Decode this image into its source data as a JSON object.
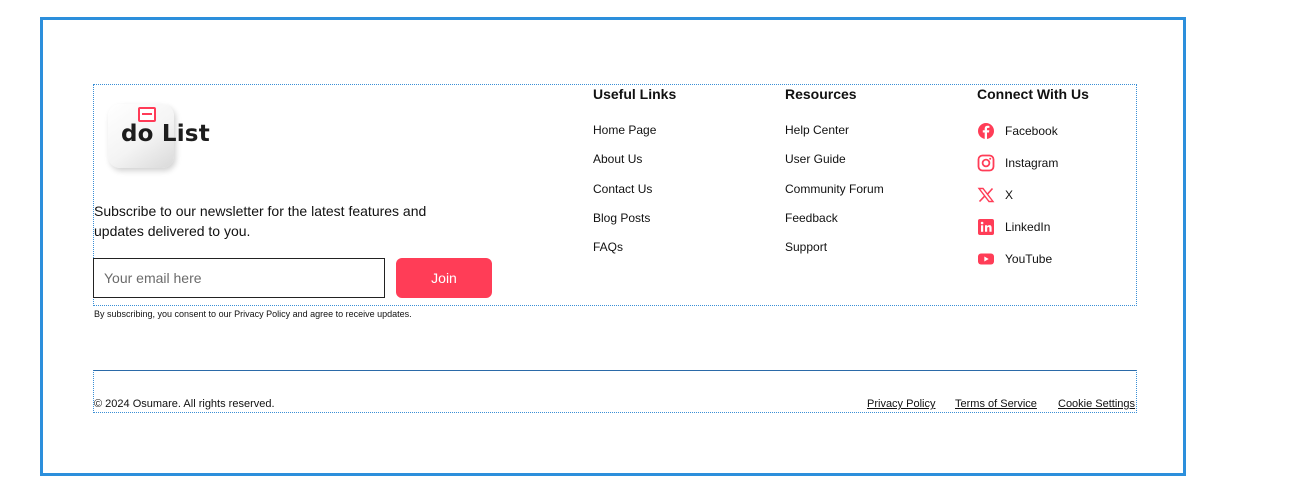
{
  "brand": {
    "logo_text": "do List"
  },
  "newsletter": {
    "description": "Subscribe to our newsletter for the latest features and updates delivered to you.",
    "email_placeholder": "Your email here",
    "join_label": "Join",
    "consent": "By subscribing, you consent to our Privacy Policy and agree to receive updates.",
    "accent_color": "#ff3d57"
  },
  "useful_links": {
    "heading": "Useful Links",
    "items": [
      "Home Page",
      "About Us",
      "Contact Us",
      "Blog Posts",
      "FAQs"
    ]
  },
  "resources": {
    "heading": "Resources",
    "items": [
      "Help Center",
      "User Guide",
      "Community Forum",
      "Feedback",
      "Support"
    ]
  },
  "connect": {
    "heading": "Connect With Us",
    "items": [
      {
        "label": "Facebook",
        "icon": "facebook-icon"
      },
      {
        "label": "Instagram",
        "icon": "instagram-icon"
      },
      {
        "label": "X",
        "icon": "x-icon"
      },
      {
        "label": "LinkedIn",
        "icon": "linkedin-icon"
      },
      {
        "label": "YouTube",
        "icon": "youtube-icon"
      }
    ],
    "icon_color": "#ff3d57"
  },
  "bottom": {
    "copyright": "© 2024 Osumare. All rights reserved.",
    "links": [
      "Privacy Policy",
      "Terms of Service",
      "Cookie Settings"
    ]
  }
}
